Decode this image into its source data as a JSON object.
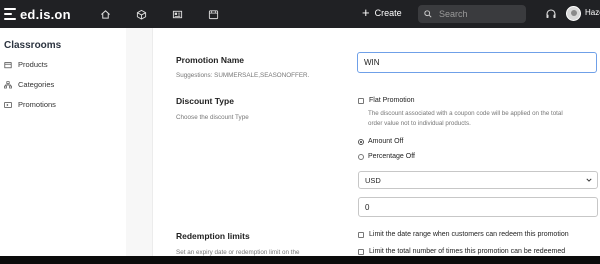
{
  "app": {
    "brand": "ed.is.on",
    "nav_icons": [
      "home-icon",
      "cube-icon",
      "news-icon",
      "store-icon"
    ],
    "create_label": "Create",
    "search_placeholder": "Search",
    "user_name": "Hazel"
  },
  "sidebar": {
    "title": "Classrooms",
    "items": [
      {
        "label": "Products",
        "icon": "products-icon"
      },
      {
        "label": "Categories",
        "icon": "categories-icon"
      },
      {
        "label": "Promotions",
        "icon": "promotions-icon"
      }
    ]
  },
  "form": {
    "promotion_name": {
      "label": "Promotion Name",
      "suggestions": "Suggestions: SUMMERSALE,SEASONOFFER.",
      "value": "WIN"
    },
    "discount_type": {
      "label": "Discount Type",
      "hint": "Choose the discount Type",
      "flat_label": "Flat Promotion",
      "flat_desc_line1": "The discount associated with a coupon code will be applied on the total",
      "flat_desc_line2": "order value not to individual products.",
      "amount_off": "Amount Off",
      "percentage_off": "Percentage Off",
      "selected": "Amount Off",
      "currency": "USD",
      "amount_value": "0"
    },
    "redemption": {
      "label": "Redemption limits",
      "hint": "Set an expiry date or redemption limit on the",
      "option1": "Limit the date range when customers can redeem this promotion",
      "option2": "Limit the total number of times this promotion can be redeemed"
    }
  },
  "colors": {
    "topbar": "#202124",
    "focus_border": "#6fa0e8"
  }
}
